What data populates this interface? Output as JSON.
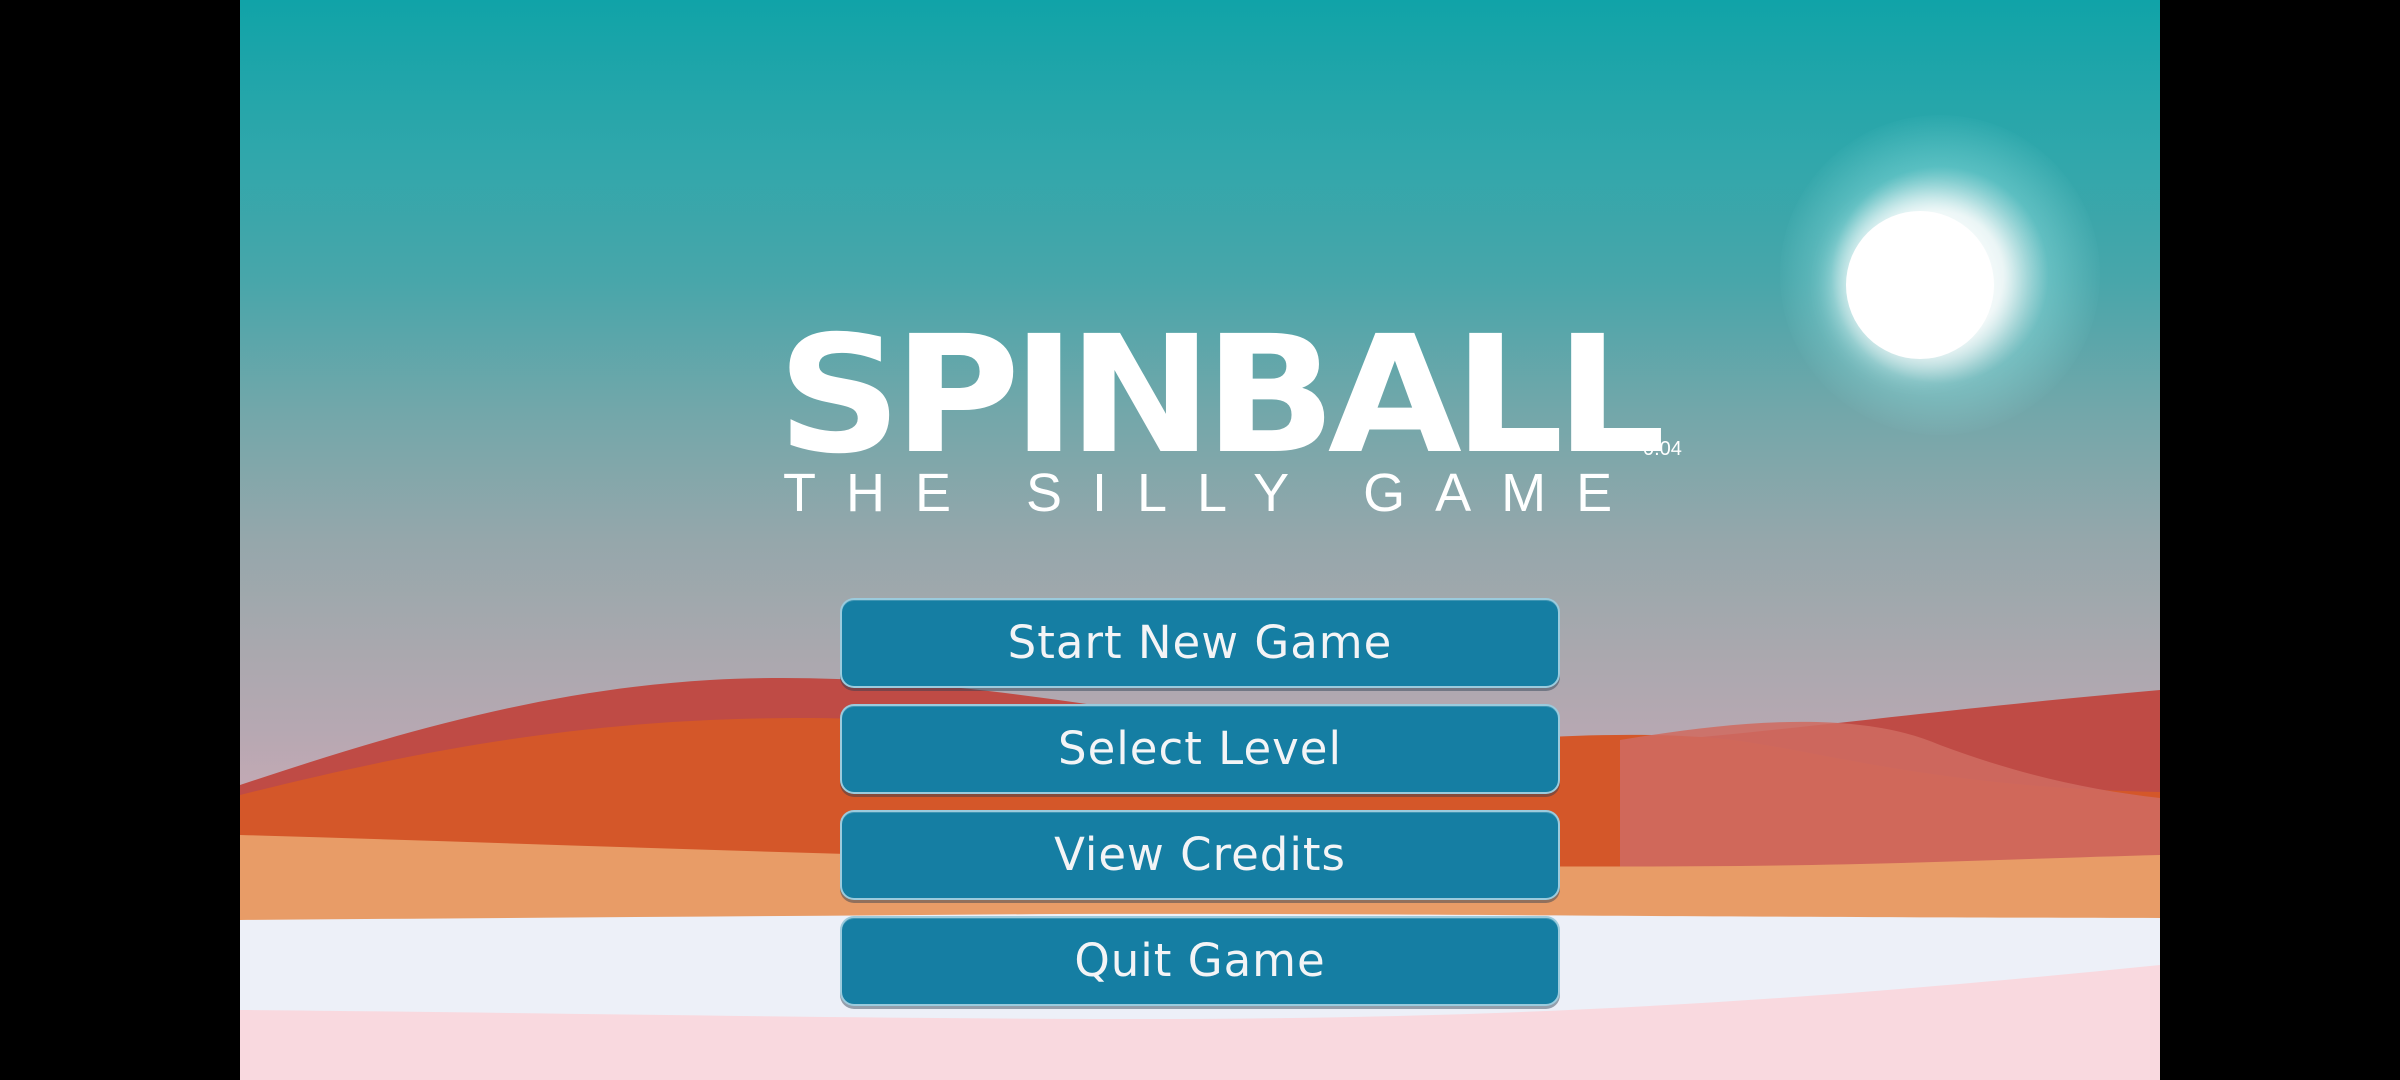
{
  "game": {
    "title": "SPINBALL",
    "subtitle": "THE SILLY GAME",
    "version": "0.04"
  },
  "menu": {
    "buttons": [
      {
        "label": "Start New Game"
      },
      {
        "label": "Select Level"
      },
      {
        "label": "View Credits"
      },
      {
        "label": "Quit Game"
      }
    ]
  },
  "colors": {
    "sky_top": "#10a3a8",
    "sky_bottom": "#c9aab5",
    "button_fill": "#157ea3",
    "dunes_red": "#c94b3f",
    "dunes_orange": "#d76126",
    "sand_light": "#e9a06c",
    "snow": "#edf0f8",
    "ground_pink": "#f9d9df"
  }
}
